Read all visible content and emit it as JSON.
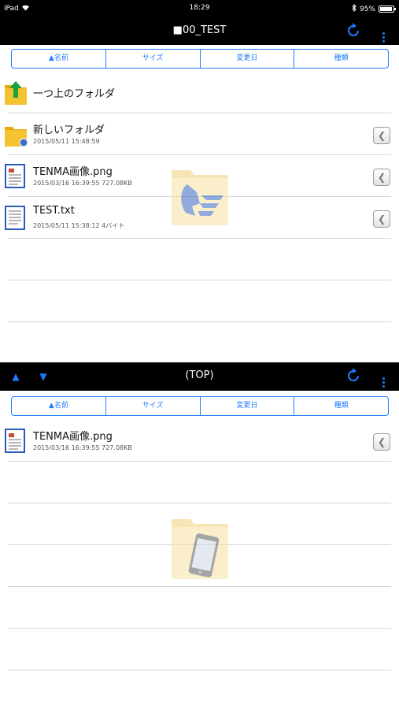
{
  "status_bar": {
    "device": "iPad",
    "time": "18:29",
    "battery": "95%",
    "battery_level": 0.95
  },
  "top_pane": {
    "title": "■00_TEST",
    "sort": [
      "▲名前",
      "サイズ",
      "変更日",
      "種類"
    ],
    "items": [
      {
        "icon": "folder-up-icon",
        "name": "一つ上のフォルダ",
        "meta": ""
      },
      {
        "icon": "folder-icon",
        "name": "新しいフォルダ",
        "meta": "2015/05/11 15:48:59"
      },
      {
        "icon": "document-icon",
        "name": "TENMA画像.png",
        "meta": "2015/03/16 16:39:55 727.08KB"
      },
      {
        "icon": "document-icon",
        "name": "TEST.txt",
        "meta": "2015/05/11 15:38:12 4バイト"
      }
    ]
  },
  "bottom_pane": {
    "title": "(TOP)",
    "sort": [
      "▲名前",
      "サイズ",
      "変更日",
      "種類"
    ],
    "items": [
      {
        "icon": "document-icon",
        "name": "TENMA画像.png",
        "meta": "2015/03/16 16:39:55 727.08KB"
      }
    ]
  },
  "colors": {
    "accent": "#1e7bff",
    "bar": "#000000",
    "divider": "#d6d6d6",
    "folder": "#f5c332"
  }
}
